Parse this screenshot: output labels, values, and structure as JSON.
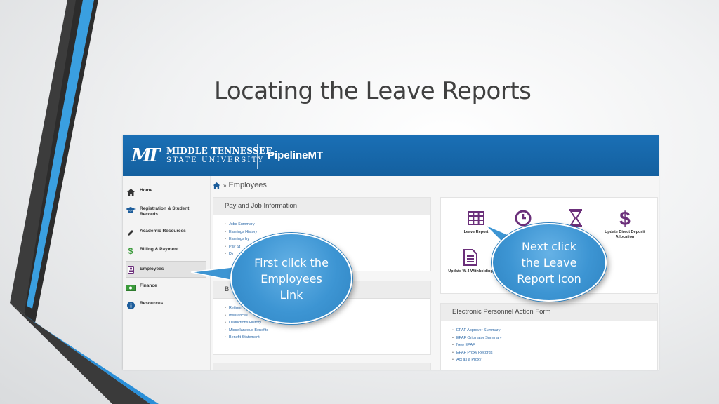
{
  "slide": {
    "title": "Locating the Leave Reports"
  },
  "header": {
    "university_line1": "MIDDLE TENNESSEE",
    "university_line2": "STATE UNIVERSITY",
    "portal": "PipelineMT",
    "brand_color": "#1a6fb5"
  },
  "breadcrumb": {
    "separator": "»",
    "current": "Employees"
  },
  "sidebar": {
    "items": [
      {
        "label": "Home",
        "icon": "home-icon"
      },
      {
        "label": "Registration & Student Records",
        "icon": "graduation-cap-icon"
      },
      {
        "label": "Academic Resources",
        "icon": "pencil-icon"
      },
      {
        "label": "Billing & Payment",
        "icon": "dollar-icon"
      },
      {
        "label": "Employees",
        "icon": "id-badge-icon"
      },
      {
        "label": "Finance",
        "icon": "money-icon"
      },
      {
        "label": "Resources",
        "icon": "info-icon"
      }
    ]
  },
  "pay_panel": {
    "title": "Pay and Job Information",
    "links": [
      "Jobs Summary",
      "Earnings History",
      "Earnings by",
      "Pay St",
      "Dir"
    ]
  },
  "benefits_panel": {
    "title": "B",
    "links": [
      "Retirem",
      "Insurances",
      "Deductions History",
      "Miscellaneous Benefits",
      "Benefit Statement"
    ]
  },
  "tiles": [
    {
      "label": "Leave Report",
      "icon": "table-icon"
    },
    {
      "label": "",
      "icon": "clock-icon"
    },
    {
      "label": "",
      "icon": "hourglass-icon"
    },
    {
      "label": "Update Direct Deposit Allocation",
      "icon": "dollar-icon"
    },
    {
      "label": "Update W-4 Withholding",
      "icon": "document-icon"
    }
  ],
  "epaf_panel": {
    "title": "Electronic Personnel Action Form",
    "links": [
      "EPAF Approver Summary",
      "EPAF Originator Summary",
      "New EPAF",
      "EPAF Proxy Records",
      "Act as a Proxy"
    ]
  },
  "callouts": {
    "first": "First click the\nEmployees\nLink",
    "second": "Next click\nthe Leave\nReport Icon",
    "color": "#3d95d3"
  }
}
